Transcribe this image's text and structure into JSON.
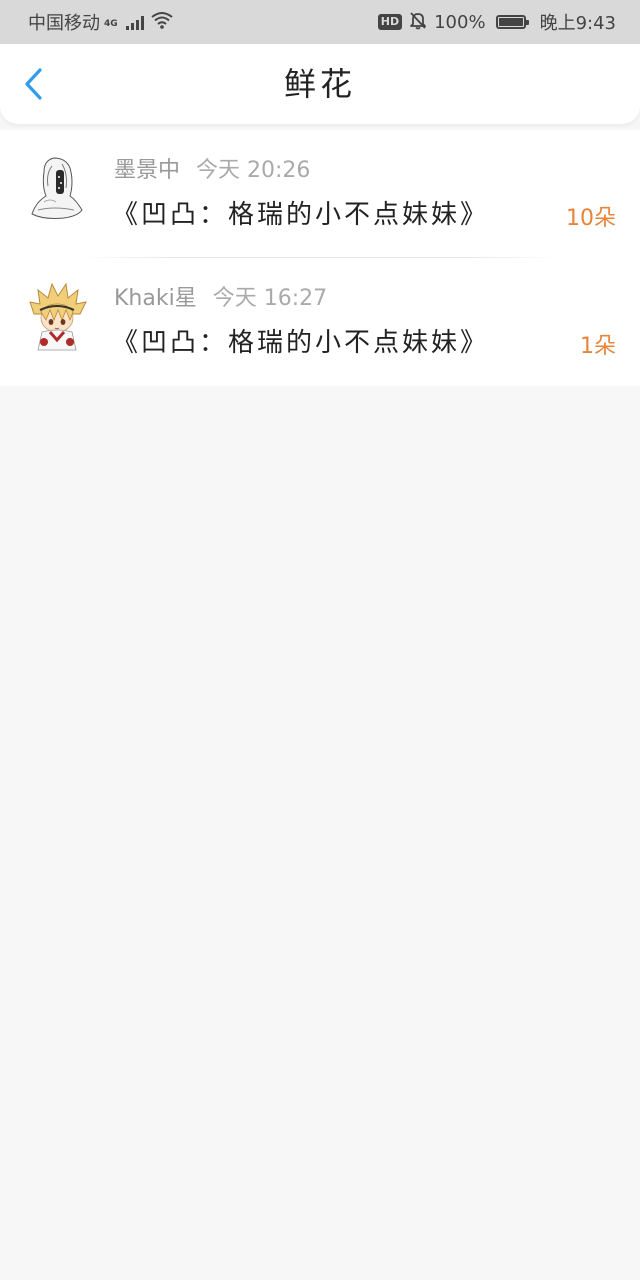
{
  "status_bar": {
    "carrier": "中国移动",
    "network": "4G",
    "battery_text": "100%",
    "time": "晚上9:43",
    "hd_label": "HD",
    "battery_level": 1.0
  },
  "header": {
    "title": "鲜花"
  },
  "list": {
    "items": [
      {
        "user": "墨景中",
        "time": "今天 20:26",
        "book": "《凹凸：格瑞的小不点妹妹》",
        "count": "10朵"
      },
      {
        "user": "Khaki星",
        "time": "今天 16:27",
        "book": "《凹凸：格瑞的小不点妹妹》",
        "count": "1朵"
      }
    ]
  },
  "colors": {
    "accent": "#2f9bea",
    "count": "#e8843a",
    "status_bar_bg": "#d9d9d9",
    "page_bg": "#f8f7f7"
  },
  "icons": {
    "back": "chevron-left-icon",
    "wifi": "wifi-icon",
    "signal": "signal-icon",
    "mute": "bell-off-icon",
    "battery": "battery-icon"
  }
}
